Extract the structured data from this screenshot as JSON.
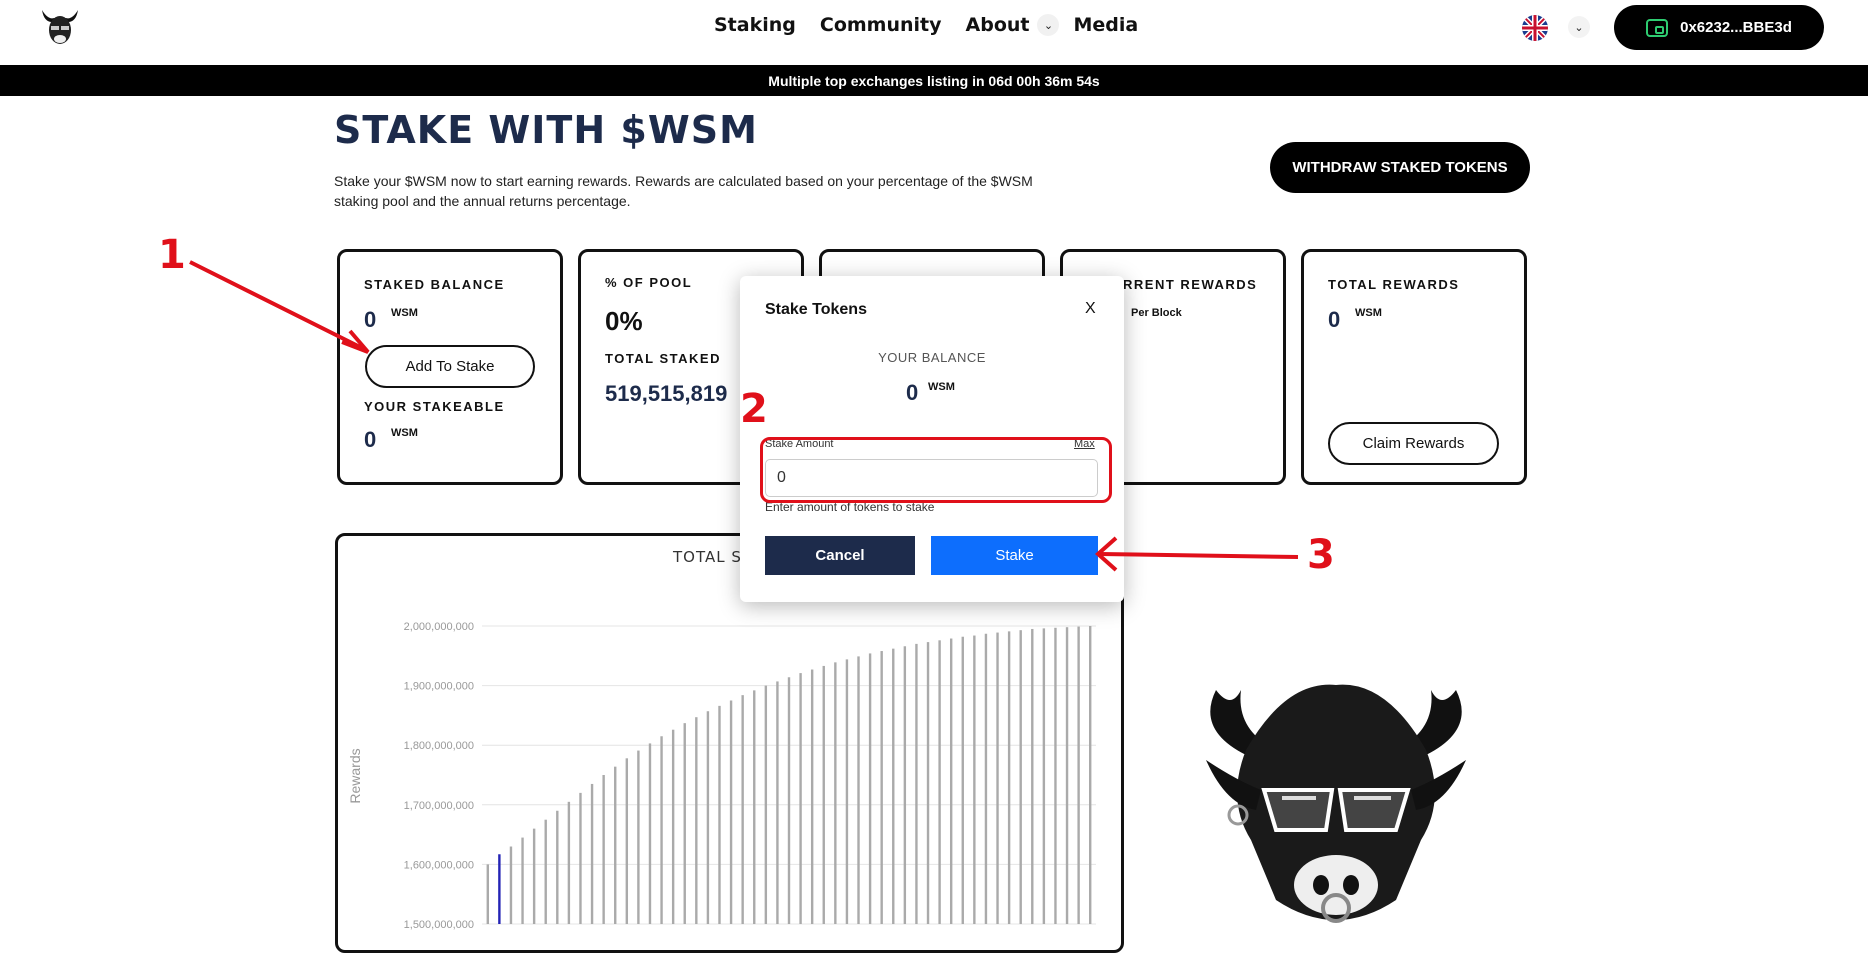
{
  "nav": {
    "links": [
      "Staking",
      "Community",
      "About",
      "Media"
    ],
    "wallet_address": "0x6232...BBE3d"
  },
  "banner": {
    "text": "Multiple top exchanges listing in 06d 00h 36m 54s"
  },
  "page": {
    "title": "STAKE WITH $WSM",
    "description": "Stake your $WSM now to start earning rewards. Rewards are calculated based on your percentage of the $WSM staking pool and the annual returns percentage.",
    "withdraw_label": "WITHDRAW STAKED TOKENS"
  },
  "cards": {
    "staked_balance_label": "STAKED BALANCE",
    "staked_balance_value": "0",
    "unit": "WSM",
    "add_to_stake_label": "Add To Stake",
    "stakeable_label": "YOUR STAKEABLE",
    "stakeable_value": "0",
    "pool_label": "% OF POOL",
    "pool_value": "0%",
    "total_staked_label": "TOTAL STAKED",
    "total_staked_value": "519,515,819",
    "current_rewards_label": "RRENT REWARDS",
    "current_rewards_sub": "Per Block",
    "total_rewards_label": "TOTAL REWARDS",
    "total_rewards_value": "0",
    "claim_label": "Claim Rewards"
  },
  "modal": {
    "title": "Stake Tokens",
    "close": "X",
    "balance_label": "YOUR BALANCE",
    "balance_value": "0",
    "balance_unit": "WSM",
    "amount_label": "Stake Amount",
    "max_label": "Max",
    "amount_value": "0",
    "hint": "Enter amount of tokens to stake",
    "cancel_label": "Cancel",
    "stake_label": "Stake"
  },
  "annotations": {
    "one": "1",
    "two": "2",
    "three": "3"
  },
  "chart_data": {
    "type": "bar",
    "title": "TOTAL SU",
    "ylabel": "Rewards",
    "xlabel": "",
    "ylim": [
      1500000000,
      2000000000
    ],
    "yticks": [
      "2,000,000,000",
      "1,900,000,000",
      "1,800,000,000",
      "1,700,000,000",
      "1,600,000,000",
      "1,500,000,000"
    ],
    "values": [
      1600000000,
      1617000000,
      1630000000,
      1645000000,
      1660000000,
      1675000000,
      1690000000,
      1705000000,
      1720000000,
      1735000000,
      1750000000,
      1764000000,
      1778000000,
      1791000000,
      1803000000,
      1815000000,
      1826000000,
      1837000000,
      1847000000,
      1857000000,
      1866000000,
      1875000000,
      1884000000,
      1892000000,
      1900000000,
      1907000000,
      1914000000,
      1921000000,
      1927000000,
      1933000000,
      1939000000,
      1944000000,
      1949000000,
      1954000000,
      1958000000,
      1962000000,
      1966000000,
      1970000000,
      1973000000,
      1976000000,
      1979000000,
      1982000000,
      1984000000,
      1987000000,
      1989000000,
      1991000000,
      1993000000,
      1995000000,
      1996000000,
      1997000000,
      1998000000,
      1999000000,
      2000000000
    ],
    "highlight_index": 1,
    "colors": {
      "bar": "#aaaaaa",
      "highlight": "#2323b5"
    }
  }
}
